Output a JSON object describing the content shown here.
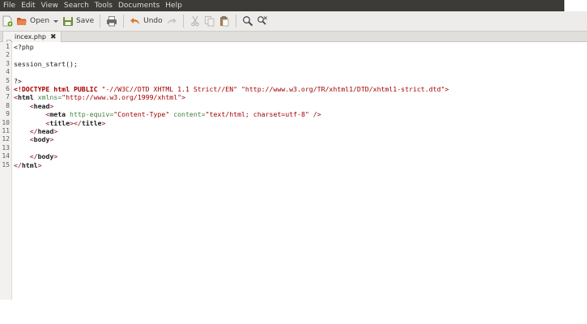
{
  "menubar": {
    "items": [
      "File",
      "Edit",
      "View",
      "Search",
      "Tools",
      "Documents",
      "Help"
    ]
  },
  "toolbar": {
    "new_icon": "new-document-icon",
    "open_label": "Open",
    "save_label": "Save",
    "print_icon": "printer-icon",
    "undo_label": "Undo",
    "redo_icon": "redo-arrow-icon",
    "cut_icon": "scissors-icon",
    "copy_icon": "copy-icon",
    "paste_icon": "paste-icon",
    "find_icon": "magnifier-icon",
    "replace_icon": "find-replace-icon"
  },
  "tab": {
    "filename": "incex.php",
    "close_symbol": "✖"
  },
  "editor": {
    "line_numbers": [
      "1",
      "2",
      "3",
      "4",
      "5",
      "6",
      "7",
      "8",
      "9",
      "10",
      "11",
      "12",
      "13",
      "14",
      "15"
    ],
    "lines": [
      [
        {
          "t": "<?php",
          "c": "p"
        }
      ],
      [],
      [
        {
          "t": "session_start();",
          "c": "p"
        }
      ],
      [],
      [
        {
          "t": "?>",
          "c": "p"
        }
      ],
      [
        {
          "t": "<!DOCTYPE html PUBLIC ",
          "c": "doct"
        },
        {
          "t": "\"-//W3C//DTD XHTML 1.1 Strict//EN\" \"http://www.w3.org/TR/xhtml1/DTD/xhtml1-strict.dtd\">",
          "c": "str"
        }
      ],
      [
        {
          "t": "<",
          "c": "tag"
        },
        {
          "t": "html",
          "c": "kw"
        },
        {
          "t": " xmlns=",
          "c": "attr"
        },
        {
          "t": "\"http://www.w3.org/1999/xhtml\"",
          "c": "str"
        },
        {
          "t": ">",
          "c": "tag"
        }
      ],
      [
        {
          "t": "    <",
          "c": "tag"
        },
        {
          "t": "head",
          "c": "kw"
        },
        {
          "t": ">",
          "c": "tag"
        }
      ],
      [
        {
          "t": "        <",
          "c": "tag"
        },
        {
          "t": "meta",
          "c": "kw"
        },
        {
          "t": " http-equiv=",
          "c": "attr"
        },
        {
          "t": "\"Content-Type\"",
          "c": "str"
        },
        {
          "t": " content=",
          "c": "attr"
        },
        {
          "t": "\"text/html; charset=utf-8\"",
          "c": "str"
        },
        {
          "t": " />",
          "c": "tag"
        }
      ],
      [
        {
          "t": "        <",
          "c": "tag"
        },
        {
          "t": "title",
          "c": "kw"
        },
        {
          "t": "></",
          "c": "tag"
        },
        {
          "t": "title",
          "c": "kw"
        },
        {
          "t": ">",
          "c": "tag"
        }
      ],
      [
        {
          "t": "    </",
          "c": "tag"
        },
        {
          "t": "head",
          "c": "kw"
        },
        {
          "t": ">",
          "c": "tag"
        }
      ],
      [
        {
          "t": "    <",
          "c": "tag"
        },
        {
          "t": "body",
          "c": "kw"
        },
        {
          "t": ">",
          "c": "tag"
        }
      ],
      [],
      [
        {
          "t": "    </",
          "c": "tag"
        },
        {
          "t": "body",
          "c": "kw"
        },
        {
          "t": ">",
          "c": "tag"
        }
      ],
      [
        {
          "t": "</",
          "c": "tag"
        },
        {
          "t": "html",
          "c": "kw"
        },
        {
          "t": ">",
          "c": "tag"
        }
      ]
    ]
  }
}
